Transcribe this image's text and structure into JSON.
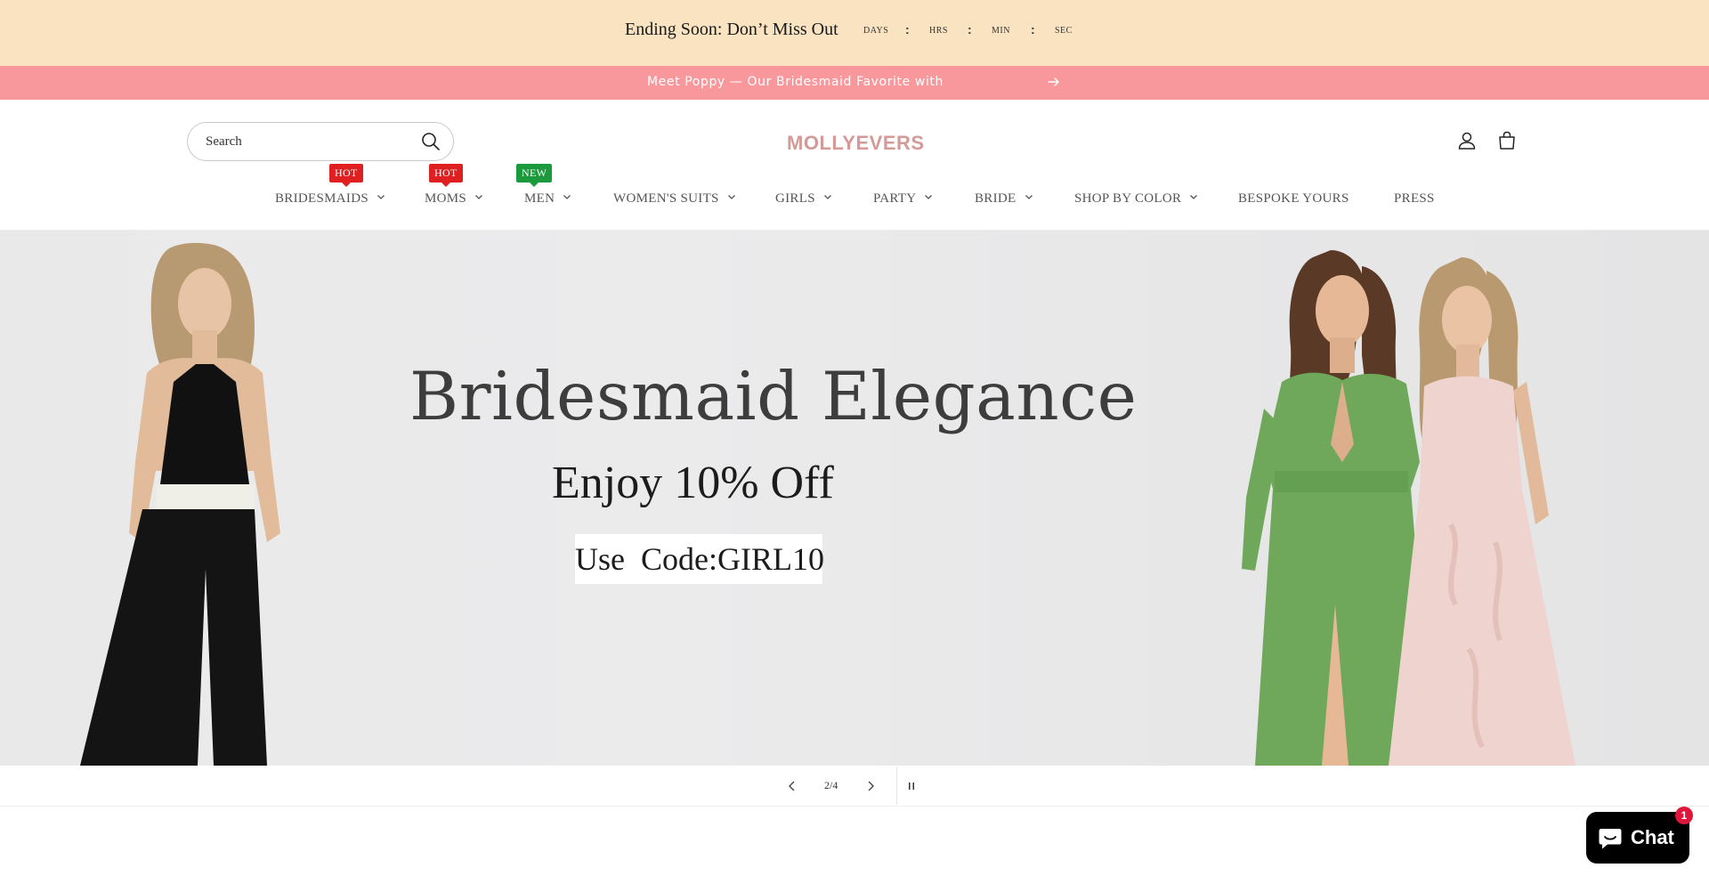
{
  "countdown": {
    "title": "Ending Soon: Don’t Miss Out",
    "units": [
      "DAYS",
      "HRS",
      "MIN",
      "SEC"
    ],
    "separator": ":"
  },
  "announcement": {
    "text": "Meet Poppy — Our Bridesmaid Favorite with",
    "icon": "arrow-right-icon"
  },
  "header": {
    "search_placeholder": "Search",
    "logo": "MOLLYEVERS",
    "icons": [
      "search-icon",
      "account-icon",
      "cart-icon"
    ]
  },
  "nav": {
    "items": [
      {
        "label": "BRIDESMAIDS",
        "has_dropdown": true,
        "badge": "HOT"
      },
      {
        "label": "MOMS",
        "has_dropdown": true,
        "badge": "HOT"
      },
      {
        "label": "MEN",
        "has_dropdown": true,
        "badge": "NEW"
      },
      {
        "label": "WOMEN'S SUITS",
        "has_dropdown": true
      },
      {
        "label": "GIRLS",
        "has_dropdown": true
      },
      {
        "label": "PARTY",
        "has_dropdown": true
      },
      {
        "label": "BRIDE",
        "has_dropdown": true
      },
      {
        "label": "SHOP BY COLOR",
        "has_dropdown": true
      },
      {
        "label": "BESPOKE YOURS",
        "has_dropdown": false
      },
      {
        "label": "PRESS",
        "has_dropdown": false
      }
    ],
    "badge_colors": {
      "hot": "#e02020",
      "new": "#1a9a3c"
    }
  },
  "hero": {
    "title": "Bridesmaid Elegance",
    "subtitle": "Enjoy 10% Off",
    "code_text": "Use  Code:GIRL10"
  },
  "slider": {
    "counter": "2/4",
    "current": 2,
    "total": 4
  },
  "chat": {
    "label": "Chat",
    "unread": "1"
  },
  "colors": {
    "countdown_bg": "#f9e3c1",
    "announcement_bg": "#f8989c",
    "logo": "#d49a97",
    "chat_badge": "#e0153a"
  }
}
